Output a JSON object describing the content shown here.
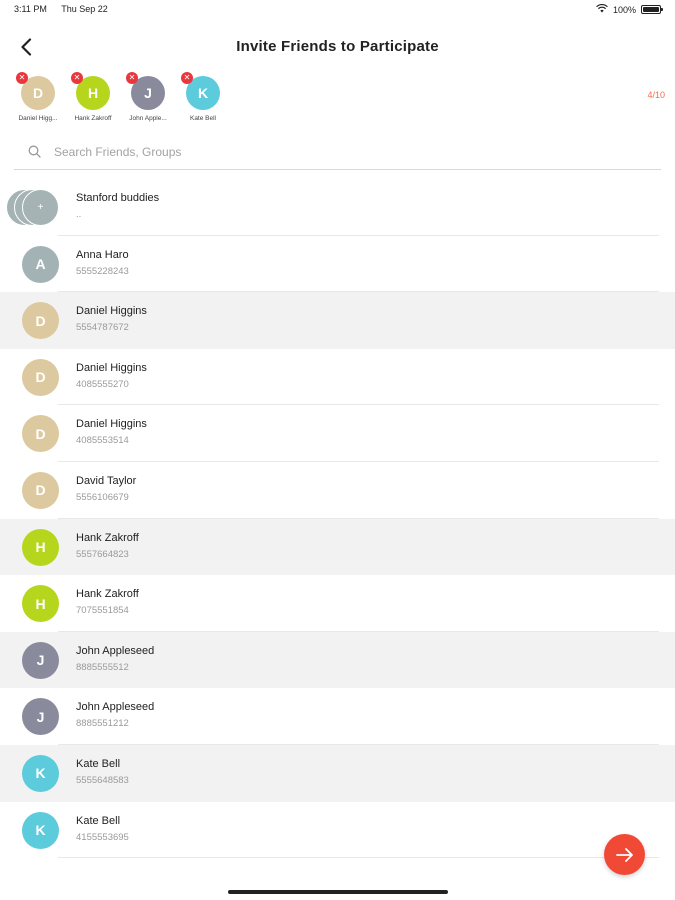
{
  "status_bar": {
    "time": "3:11 PM",
    "date": "Thu Sep 22",
    "battery": "100%",
    "battery_level": 1.0
  },
  "header": {
    "title": "Invite Friends to Participate",
    "back_icon": "chevron-left-icon"
  },
  "selected": {
    "counter": "4/10",
    "chips": [
      {
        "initial": "D",
        "label": "Daniel Higg...",
        "color": "#ddc9a0"
      },
      {
        "initial": "H",
        "label": "Hank Zakroff",
        "color": "#b6d61d"
      },
      {
        "initial": "J",
        "label": "John Apple...",
        "color": "#8a8a9d"
      },
      {
        "initial": "K",
        "label": "Kate Bell",
        "color": "#5ccbdc"
      }
    ]
  },
  "search": {
    "placeholder": "Search Friends, Groups",
    "value": ""
  },
  "contacts": [
    {
      "type": "group",
      "name": "Stanford buddies",
      "sub": "..",
      "initial": "+",
      "color": "#a6b3b5"
    },
    {
      "name": "Anna Haro",
      "sub": "5555228243",
      "initial": "A",
      "color": "#a3b3b5"
    },
    {
      "name": "Daniel Higgins",
      "sub": "5554787672",
      "initial": "D",
      "color": "#ddc9a0"
    },
    {
      "name": "Daniel Higgins",
      "sub": "4085555270",
      "initial": "D",
      "color": "#ddc9a0"
    },
    {
      "name": "Daniel Higgins",
      "sub": "4085553514",
      "initial": "D",
      "color": "#ddc9a0"
    },
    {
      "name": "David Taylor",
      "sub": "5556106679",
      "initial": "D",
      "color": "#ddc9a0"
    },
    {
      "name": "Hank Zakroff",
      "sub": "5557664823",
      "initial": "H",
      "color": "#b6d61d"
    },
    {
      "name": "Hank Zakroff",
      "sub": "7075551854",
      "initial": "H",
      "color": "#b6d61d"
    },
    {
      "name": "John Appleseed",
      "sub": "8885555512",
      "initial": "J",
      "color": "#8a8a9d"
    },
    {
      "name": "John Appleseed",
      "sub": "8885551212",
      "initial": "J",
      "color": "#8a8a9d"
    },
    {
      "name": "Kate Bell",
      "sub": "5555648583",
      "initial": "K",
      "color": "#5ccbdc"
    },
    {
      "name": "Kate Bell",
      "sub": "4155553695",
      "initial": "K",
      "color": "#5ccbdc"
    }
  ],
  "shaded_rows": [
    2,
    6,
    8,
    10
  ],
  "fab": {
    "icon": "arrow-right-icon",
    "color": "#f04a36"
  }
}
